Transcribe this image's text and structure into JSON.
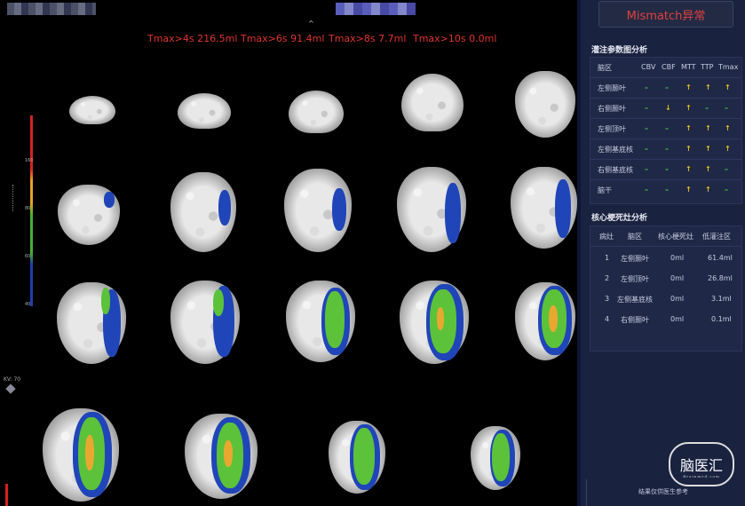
{
  "tmax_summary": [
    {
      "label": "Tmax>4s  216.5ml"
    },
    {
      "label": "Tmax>6s  91.4ml"
    },
    {
      "label": "Tmax>8s  7.7ml"
    },
    {
      "label": "Tmax>10s  0.0ml"
    }
  ],
  "color_scale": {
    "labels": [
      "160",
      "80",
      "60",
      "40"
    ],
    "colors": {
      "high": "#d42020",
      "mid_high": "#e8a028",
      "mid": "#48b030",
      "low": "#1e3ea8"
    }
  },
  "viewer": {
    "kv_label": "KV: 70"
  },
  "sidebar": {
    "mismatch_button": "Mismatch异常",
    "perfusion_title": "灌注参数图分析",
    "perfusion_headers": [
      "脑区",
      "CBV",
      "CBF",
      "MTT",
      "TTP",
      "Tmax"
    ],
    "perfusion_rows": [
      {
        "region": "左侧颞叶",
        "cbv": "–",
        "cbf": "–",
        "mtt": "↑",
        "ttp": "↑",
        "tmax": "↑"
      },
      {
        "region": "右侧颞叶",
        "cbv": "–",
        "cbf": "↓",
        "mtt": "↑",
        "ttp": "–",
        "tmax": "–"
      },
      {
        "region": "左侧顶叶",
        "cbv": "–",
        "cbf": "–",
        "mtt": "↑",
        "ttp": "↑",
        "tmax": "↑"
      },
      {
        "region": "左侧基底核",
        "cbv": "–",
        "cbf": "–",
        "mtt": "↑",
        "ttp": "↑",
        "tmax": "↑"
      },
      {
        "region": "右侧基底核",
        "cbv": "–",
        "cbf": "–",
        "mtt": "↑",
        "ttp": "↑",
        "tmax": "–"
      },
      {
        "region": "脑干",
        "cbv": "–",
        "cbf": "–",
        "mtt": "↑",
        "ttp": "↑",
        "tmax": "–"
      }
    ],
    "core_title": "核心梗死灶分析",
    "core_headers": [
      "病灶",
      "脑区",
      "核心梗死灶",
      "低灌注区"
    ],
    "core_rows": [
      {
        "id": "1",
        "region": "左侧颞叶",
        "core": "0ml",
        "low": "61.4ml"
      },
      {
        "id": "2",
        "region": "左侧顶叶",
        "core": "0ml",
        "low": "26.8ml"
      },
      {
        "id": "3",
        "region": "左侧基底核",
        "core": "0ml",
        "low": "3.1ml"
      },
      {
        "id": "4",
        "region": "右侧颞叶",
        "core": "0ml",
        "low": "0.1ml"
      }
    ],
    "logo_text": "脑医汇",
    "logo_sub": "Brainmed.com",
    "footnote": "结果仅供医生参考"
  }
}
